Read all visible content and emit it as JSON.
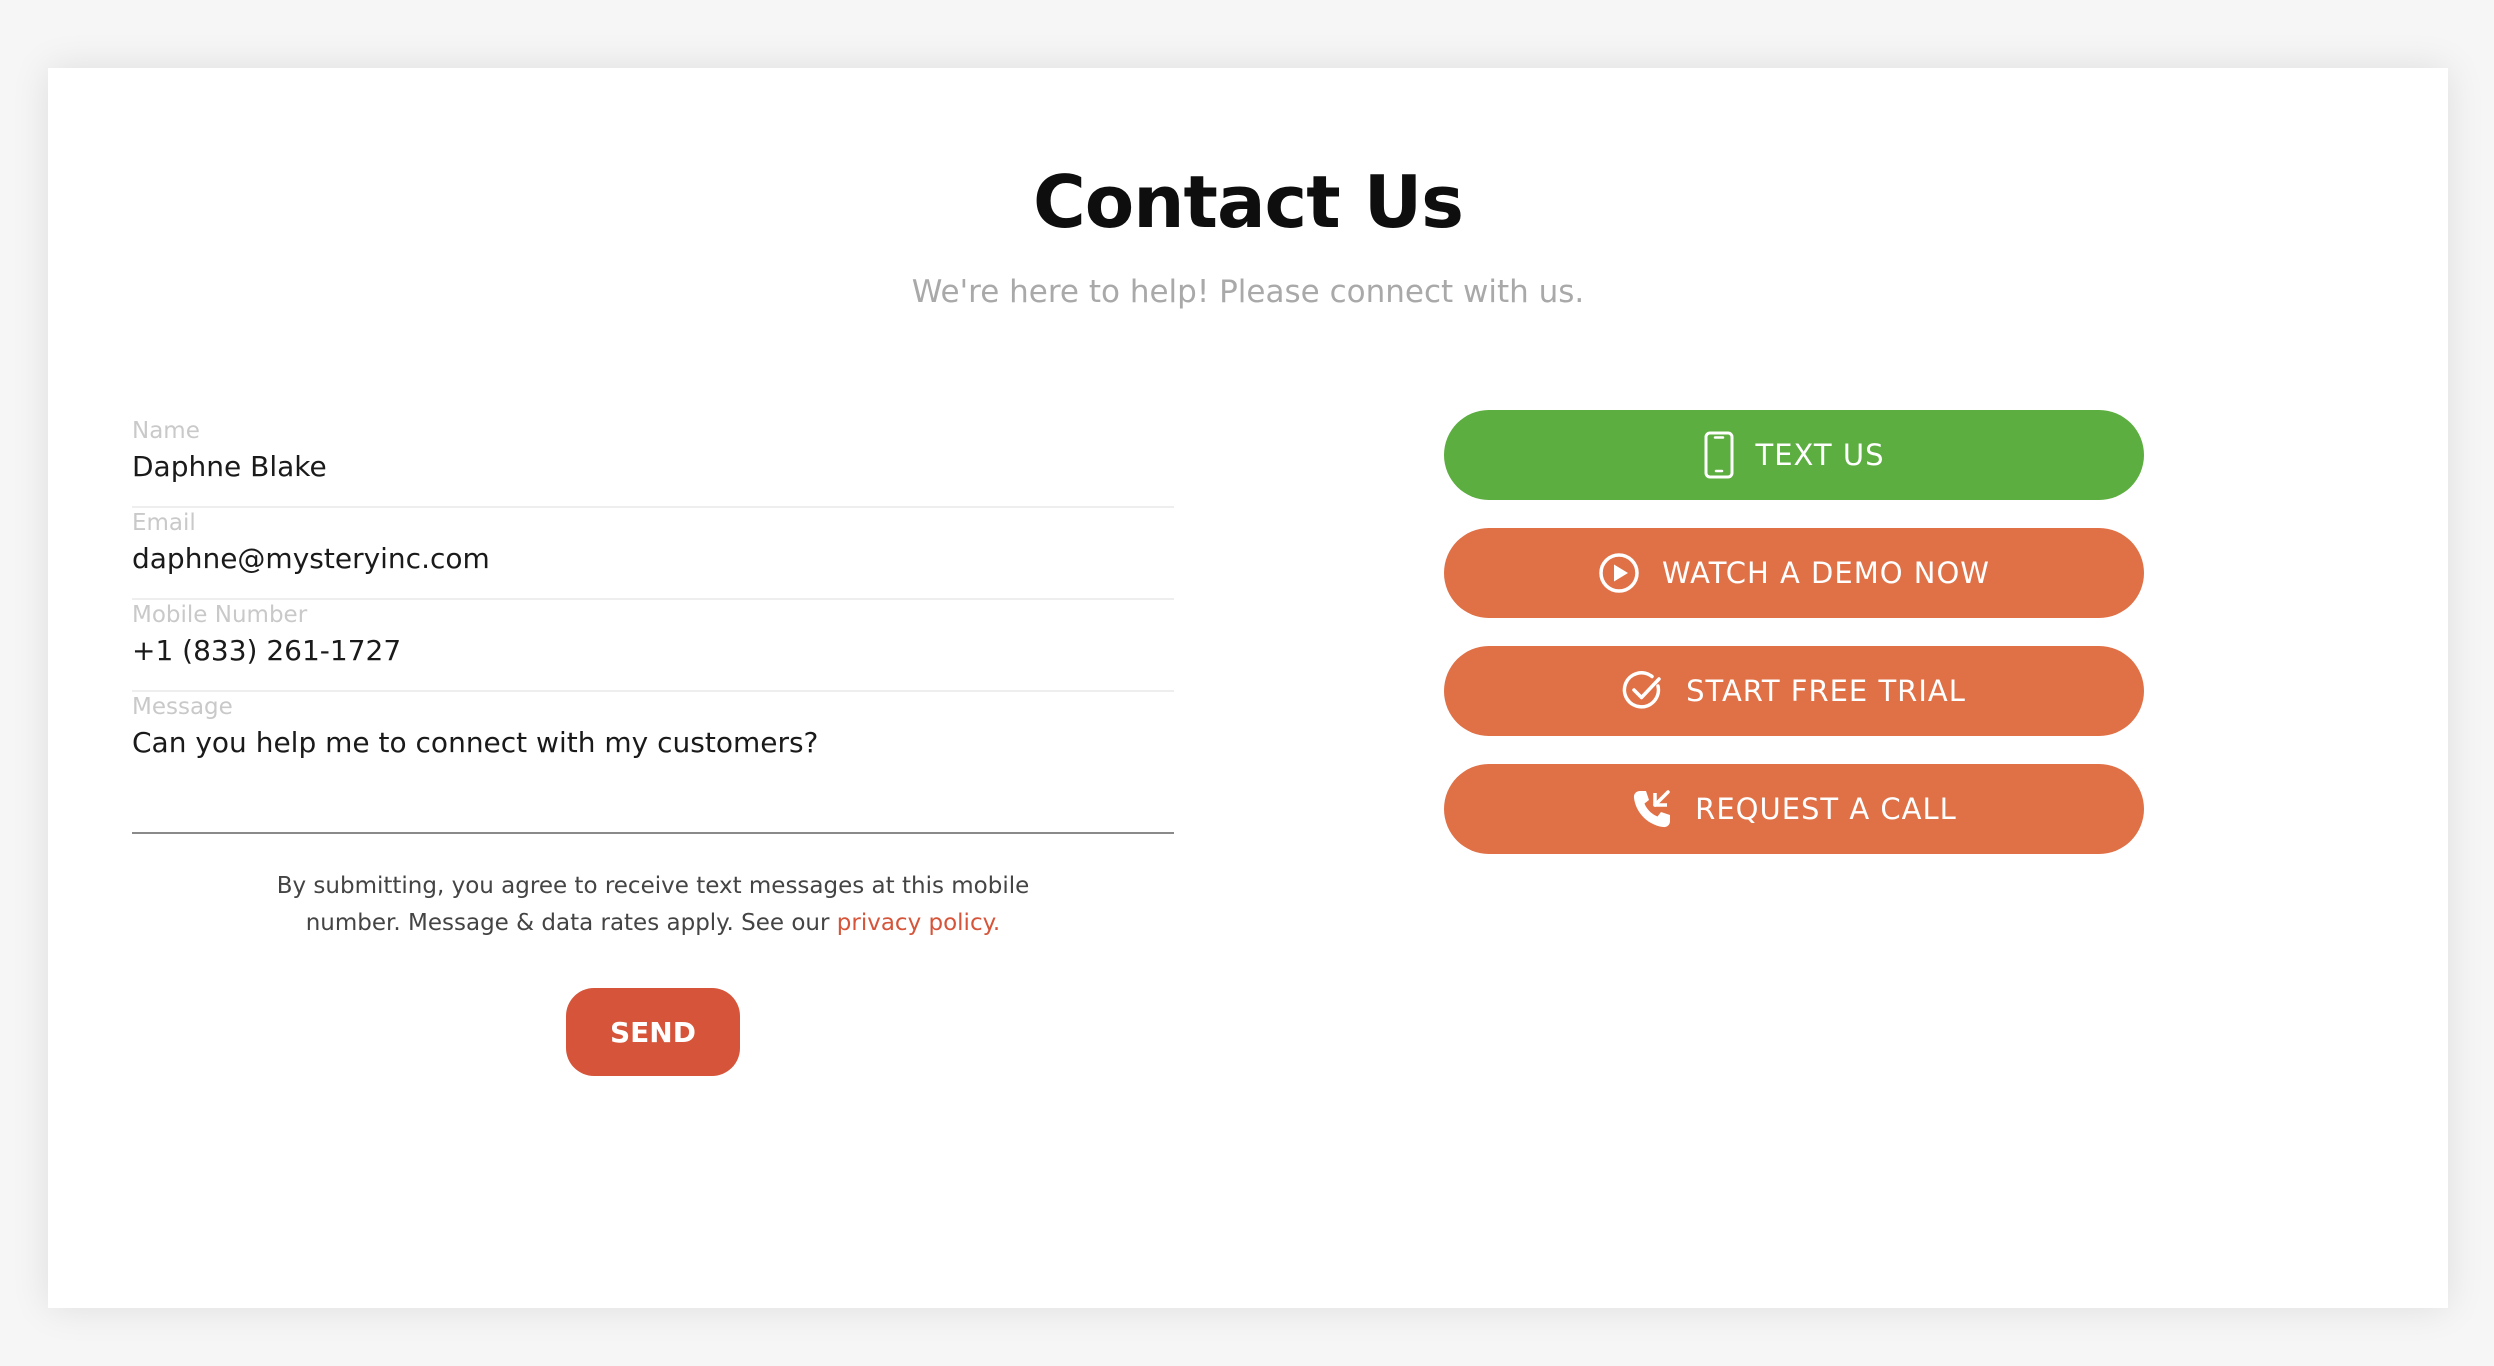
{
  "header": {
    "title": "Contact Us",
    "subtitle": "We're here to help! Please connect with us."
  },
  "form": {
    "name": {
      "label": "Name",
      "value": "Daphne Blake"
    },
    "email": {
      "label": "Email",
      "value": "daphne@mysteryinc.com"
    },
    "mobile": {
      "label": "Mobile Number",
      "value": "+1 (833) 261-1727"
    },
    "message": {
      "label": "Message",
      "value": "Can you help me to connect with my customers?"
    },
    "consent_line1": "By submitting, you agree to receive text messages at this mobile",
    "consent_line2": "number. Message & data rates apply. See our ",
    "privacy_link": "privacy policy.",
    "send_label": "SEND"
  },
  "actions": [
    {
      "label": "TEXT US",
      "icon": "mobile-phone-icon",
      "color": "#5bae3f"
    },
    {
      "label": "WATCH A DEMO NOW",
      "icon": "play-circle-icon",
      "color": "#e07046"
    },
    {
      "label": "START FREE TRIAL",
      "icon": "check-circle-icon",
      "color": "#e07046"
    },
    {
      "label": "REQUEST A CALL",
      "icon": "phone-call-icon",
      "color": "#e07046"
    }
  ],
  "colors": {
    "accent": "#d6553a",
    "green": "#5bae3f",
    "orange": "#e07046"
  }
}
